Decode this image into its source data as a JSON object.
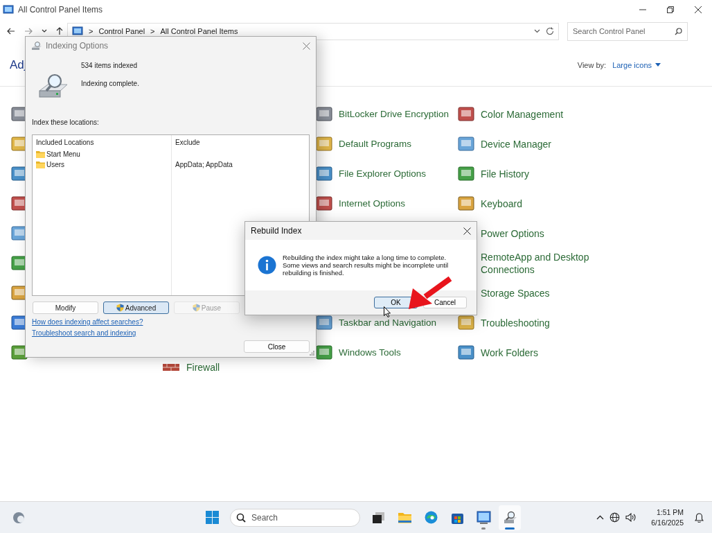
{
  "window": {
    "title": "All Control Panel Items"
  },
  "address_bar": {
    "separator": ">",
    "breadcrumbs": [
      "Control Panel",
      "All Control Panel Items"
    ]
  },
  "search": {
    "placeholder": "Search Control Panel"
  },
  "heading": "Adj",
  "view_by": {
    "label": "View by:",
    "value": "Large icons"
  },
  "columns": [
    {
      "items": [
        {
          "label": "Firewall"
        }
      ]
    },
    {
      "items": [
        {
          "label": "BitLocker Drive Encryption"
        },
        {
          "label": "Default Programs"
        },
        {
          "label": "File Explorer Options"
        },
        {
          "label": "Internet Options"
        },
        {
          "label": "Taskbar and Navigation"
        },
        {
          "label": "Windows Tools"
        }
      ]
    },
    {
      "items": [
        {
          "label": "Color Management"
        },
        {
          "label": "Device Manager"
        },
        {
          "label": "File History"
        },
        {
          "label": "Keyboard"
        },
        {
          "label": "Power Options"
        },
        {
          "label": "RemoteApp and Desktop Connections"
        },
        {
          "label": "Storage Spaces"
        },
        {
          "label": "Troubleshooting"
        },
        {
          "label": "Work Folders"
        }
      ]
    }
  ],
  "indexing_dialog": {
    "title": "Indexing Options",
    "count": "534 items indexed",
    "status": "Indexing complete.",
    "locations_label": "Index these locations:",
    "columns": [
      "Included Locations",
      "Exclude"
    ],
    "rows": [
      {
        "location": "Start Menu"
      },
      {
        "location": "Users",
        "exclude": "AppData; AppData"
      }
    ],
    "buttons": [
      {
        "label": "Modify",
        "kind": "plain",
        "focused": false,
        "disabled": false
      },
      {
        "label": "Advanced",
        "kind": "shield",
        "focused": true,
        "disabled": false
      },
      {
        "label": "Pause",
        "kind": "shield",
        "focused": false,
        "disabled": true
      }
    ],
    "links": [
      "How does indexing affect searches?",
      "Troubleshoot search and indexing"
    ],
    "close_button": "Close"
  },
  "rebuild_dialog": {
    "title": "Rebuild Index",
    "message_lines": [
      "Rebuilding the index might take a long time to complete.",
      "Some views and search results might be incomplete until",
      "rebuilding is finished."
    ],
    "buttons": [
      {
        "label": "OK",
        "focused": true
      },
      {
        "label": "Cancel",
        "focused": false
      }
    ]
  },
  "taskbar": {
    "search_placeholder": "Search",
    "time": "1:51 PM",
    "date": "6/16/2025",
    "apps": [
      {
        "kind": "start",
        "running": false,
        "active": false
      },
      {
        "kind": "taskview",
        "running": false,
        "active": false
      },
      {
        "kind": "explorer",
        "running": false,
        "active": false
      },
      {
        "kind": "edge",
        "running": false,
        "active": false
      },
      {
        "kind": "store",
        "running": false,
        "active": false
      },
      {
        "kind": "controlpanel",
        "running": true,
        "active": false
      },
      {
        "kind": "indexing",
        "running": true,
        "active": true
      }
    ]
  }
}
